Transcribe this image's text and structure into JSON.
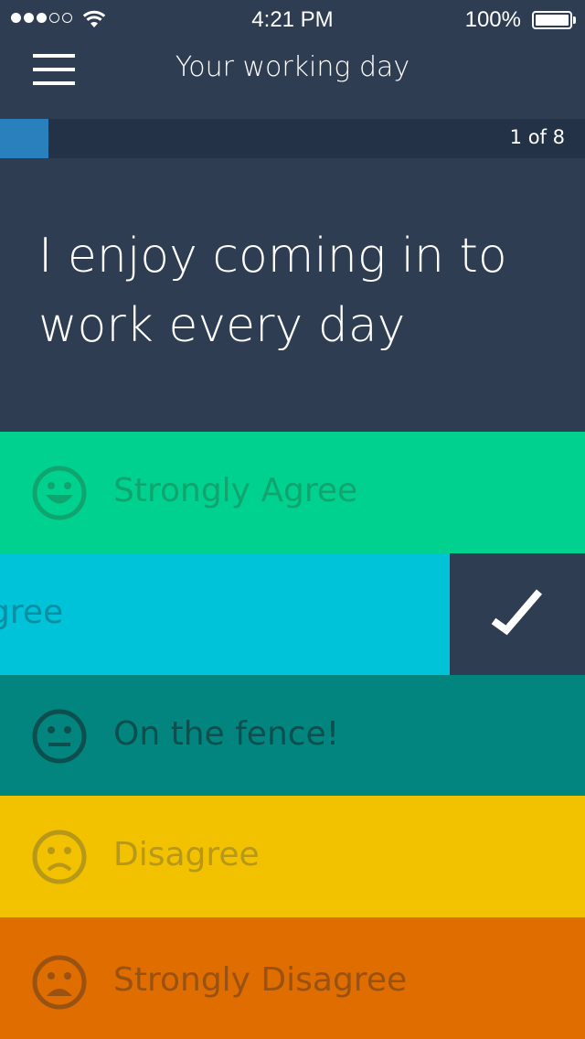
{
  "status_bar": {
    "time": "4:21 PM",
    "battery": "100%"
  },
  "nav": {
    "title": "Your working day",
    "menu_icon": "hamburger-menu-icon"
  },
  "progress": {
    "text": "1 of 8",
    "current": 1,
    "total": 8
  },
  "question": "I enjoy coming in to work every day",
  "options": [
    {
      "label": "Strongly Agree",
      "color": "#00d18f",
      "text_color": "#10a56f",
      "icon": "very-happy-face-icon"
    },
    {
      "label": "Agree",
      "color": "#00c2d8",
      "text_color": "#0a8ea1",
      "icon": "happy-face-icon",
      "selected": true,
      "visible_text": "gree"
    },
    {
      "label": "On the fence!",
      "color": "#02857f",
      "text_color": "#0c4f4e",
      "icon": "neutral-face-icon"
    },
    {
      "label": "Disagree",
      "color": "#f2c100",
      "text_color": "#b89818",
      "icon": "sad-face-icon"
    },
    {
      "label": "Strongly Disagree",
      "color": "#df6d00",
      "text_color": "#9a5213",
      "icon": "very-sad-face-icon"
    }
  ],
  "selected_icon": "checkmark-icon"
}
